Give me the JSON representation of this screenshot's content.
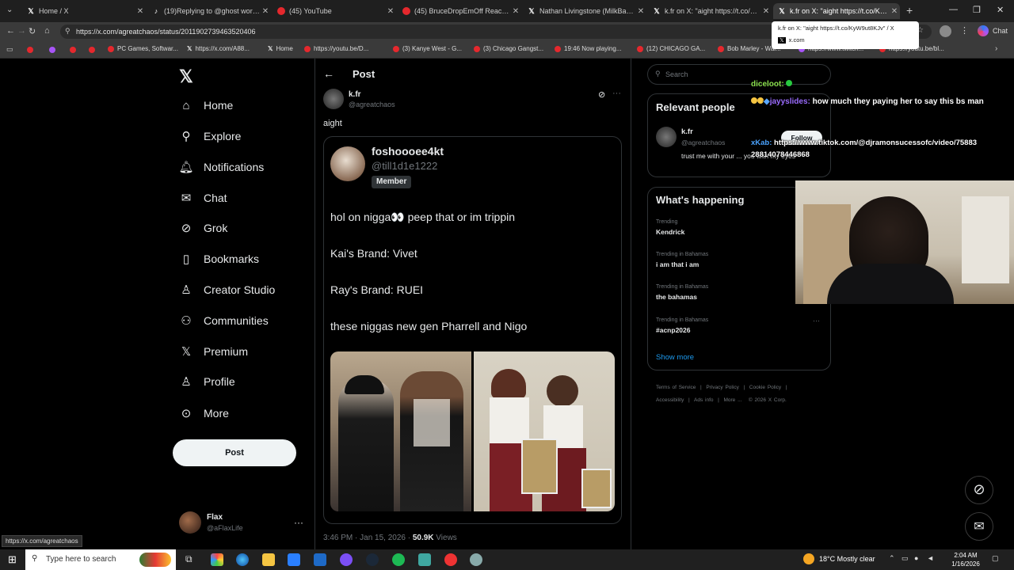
{
  "browser": {
    "tabs": [
      {
        "title": "Home / X",
        "icon": "x-logo-icon"
      },
      {
        "title": "(19)Replying to @ghost workers a",
        "icon": "tiktok-icon"
      },
      {
        "title": "(45) YouTube",
        "icon": "youtube-icon"
      },
      {
        "title": "(45) BruceDropEmOff Reacts to Ra",
        "icon": "youtube-icon"
      },
      {
        "title": "Nathan Livingstone (MilkBarTV) o",
        "icon": "x-logo-icon"
      },
      {
        "title": "k.fr on X: \"aight https://t.co/KyW9",
        "icon": "x-logo-icon"
      },
      {
        "title": "k.fr on X: \"aight https://t.co/KyW9",
        "icon": "x-logo-icon"
      }
    ],
    "tab_tooltip": {
      "title": "k.fr on X: \"aight https://t.co/KyW9ut8KJv\" / X",
      "domain": "x.com"
    },
    "url": "https://x.com/agreatchaos/status/2011902739463520406",
    "bookmarks": [
      "PC Games, Softwar...",
      "https://x.com/A88...",
      "Home",
      "https://youtu.be/D...",
      "(3) Kanye West - G...",
      "(3) Chicago Gangst...",
      "19:46 Now playing...",
      "(12) CHICAGO GA...",
      "Bob Marley - Wai...",
      "https://www.twitch...",
      "https://youtu.be/bl..."
    ],
    "chat_label": "Chat"
  },
  "nav": {
    "items": [
      {
        "label": "Home",
        "icon": "home-icon"
      },
      {
        "label": "Explore",
        "icon": "search-icon"
      },
      {
        "label": "Notifications",
        "icon": "bell-icon"
      },
      {
        "label": "Chat",
        "icon": "mail-icon"
      },
      {
        "label": "Grok",
        "icon": "grok-icon"
      },
      {
        "label": "Bookmarks",
        "icon": "bookmark-icon"
      },
      {
        "label": "Creator Studio",
        "icon": "creator-icon"
      },
      {
        "label": "Communities",
        "icon": "communities-icon"
      },
      {
        "label": "Premium",
        "icon": "x-logo-icon"
      },
      {
        "label": "Profile",
        "icon": "person-icon"
      },
      {
        "label": "More",
        "icon": "more-icon"
      }
    ],
    "post_label": "Post",
    "account": {
      "name": "Flax",
      "handle": "@aFlaxLife"
    }
  },
  "post": {
    "header": "Post",
    "author": {
      "name": "k.fr",
      "handle": "@agreatchaos"
    },
    "text": "aight",
    "quote": {
      "name": "foshoooee4kt",
      "handle": "@till1d1e1222",
      "badge": "Member",
      "lines": [
        "hol on nigga👀 peep that or im trippin",
        "Kai's Brand: Vivet",
        "Ray's Brand: RUEI",
        "these niggas new gen Pharrell and Nigo"
      ]
    },
    "meta": {
      "time": "3:46 PM · Jan 15, 2026 · ",
      "views": "50.9K",
      "views_label": " Views"
    }
  },
  "right": {
    "search_placeholder": "Search",
    "relevant": {
      "title": "Relevant people",
      "name": "k.fr",
      "handle": "@agreatchaos",
      "follow": "Follow",
      "bio": "trust me with your ... you with my eyes"
    },
    "happening": {
      "title": "What's happening",
      "trends": [
        {
          "context": "Trending",
          "name": "Kendrick"
        },
        {
          "context": "Trending in Bahamas",
          "name": "i am that i am"
        },
        {
          "context": "Trending in Bahamas",
          "name": "the bahamas"
        },
        {
          "context": "Trending in Bahamas",
          "name": "#acnp2026"
        }
      ],
      "show_more": "Show more"
    },
    "footer": [
      "Terms of Service",
      "|",
      "Privacy Policy",
      "|",
      "Cookie Policy",
      "|",
      "Accessibility",
      "|",
      "Ads info",
      "|",
      "More ...",
      "© 2026 X Corp."
    ]
  },
  "overlay_chat": [
    {
      "user": "diceloot:",
      "msg": "",
      "color": "#8be04e"
    },
    {
      "user": "jayyslides:",
      "msg": " how much they paying her to say this bs man",
      "color": "#9b6cff"
    },
    {
      "user": "xKab:",
      "msg": " https://www.tiktok.com/@djramonsucessofc/video/75883 28814078446868",
      "color": "#4aa3ff"
    }
  ],
  "status_url": "https://x.com/agreatchaos",
  "taskbar": {
    "search_placeholder": "Type here to search",
    "weather": "18°C  Mostly clear",
    "time": "2:04 AM",
    "date": "1/16/2026"
  },
  "colors": {
    "bg": "#000000",
    "text": "#e7e9ea",
    "muted": "#71767b",
    "border": "#2f3336",
    "link": "#1d9bf0"
  }
}
